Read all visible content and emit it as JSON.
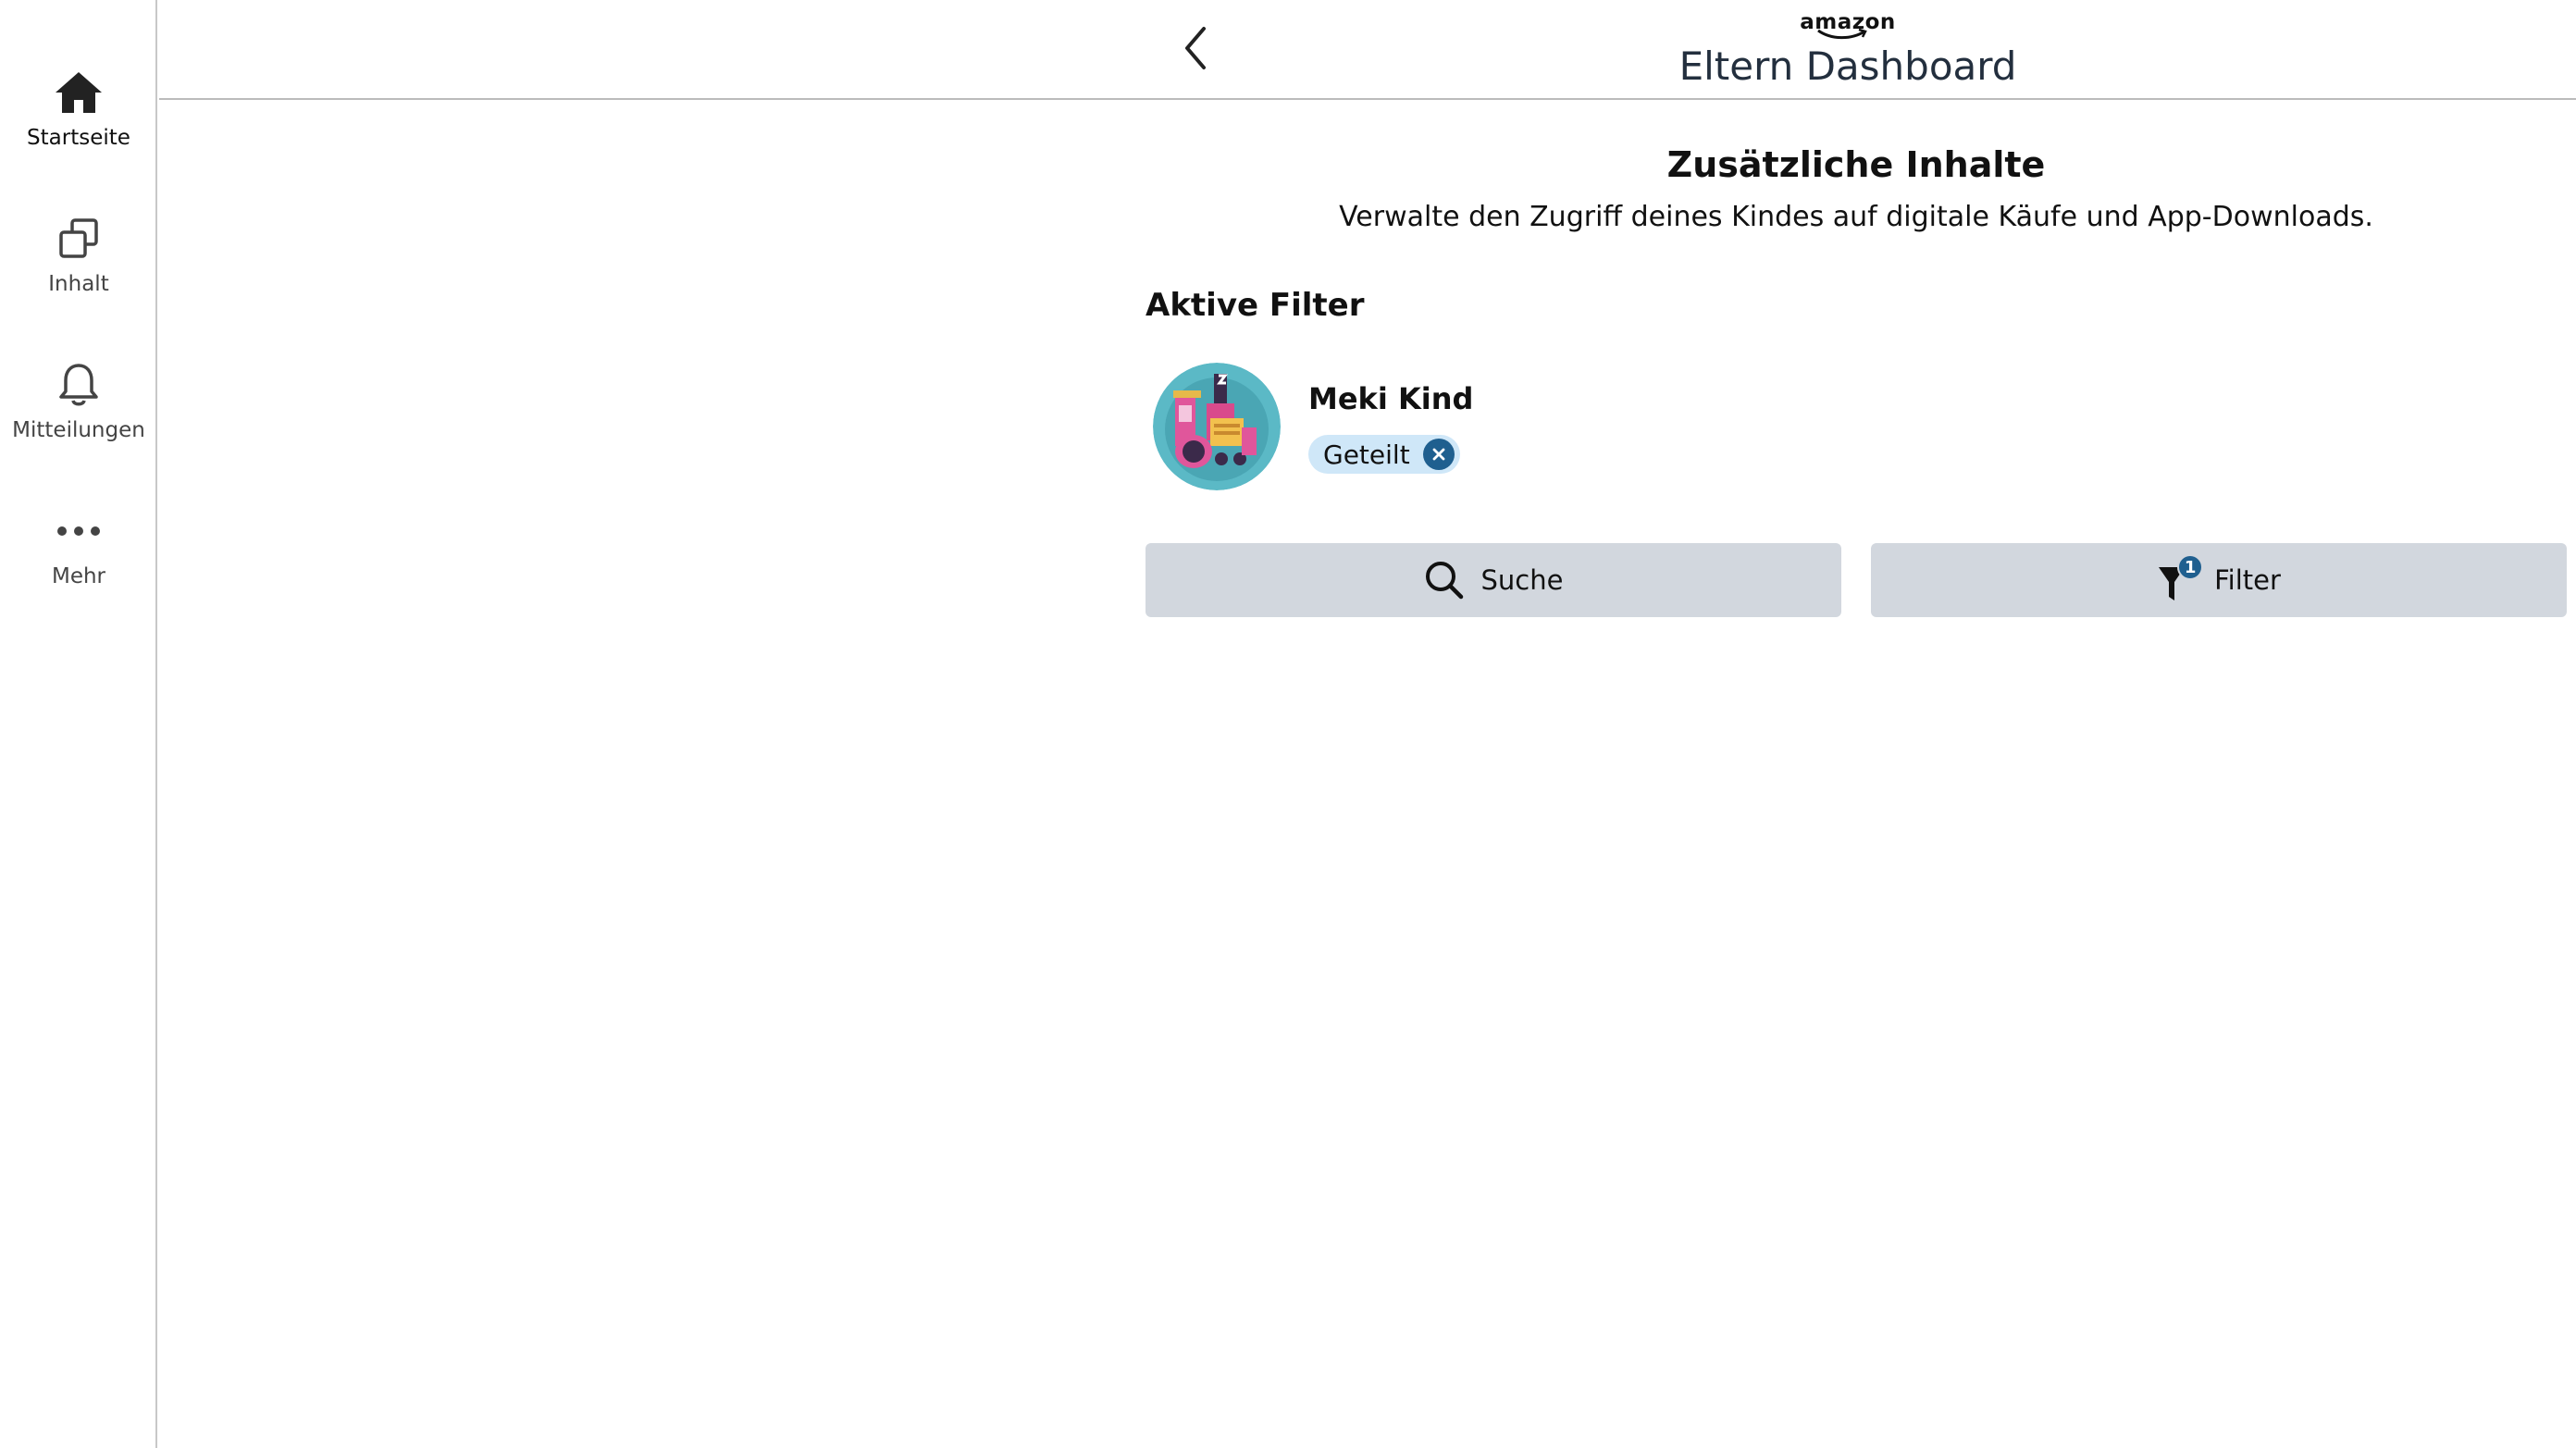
{
  "sidebar": {
    "items": [
      {
        "label": "Startseite",
        "icon": "home-icon",
        "active": true
      },
      {
        "label": "Inhalt",
        "icon": "content-copy-icon",
        "active": false
      },
      {
        "label": "Mitteilungen",
        "icon": "bell-icon",
        "active": false
      },
      {
        "label": "Mehr",
        "icon": "more-dots-icon",
        "active": false
      }
    ]
  },
  "header": {
    "brand": "amazon",
    "title": "Eltern Dashboard",
    "back_icon": "chevron-left-icon"
  },
  "main": {
    "title": "Zusätzliche Inhalte",
    "subtitle": "Verwalte den Zugriff deines Kindes auf digitale Käufe und App-Downloads.",
    "active_filters_heading": "Aktive Filter",
    "profile": {
      "name": "Meki Kind",
      "chip_label": "Geteilt",
      "avatar_icon": "train-avatar-icon"
    },
    "search_button": {
      "label": "Suche",
      "icon": "search-icon"
    },
    "filter_button": {
      "label": "Filter",
      "icon": "filter-icon",
      "badge_count": "1"
    }
  },
  "colors": {
    "button_bg": "#d2d7de",
    "chip_bg": "#cfe7f8",
    "accent": "#1f5f8f",
    "avatar_bg": "#5bb9c6"
  }
}
